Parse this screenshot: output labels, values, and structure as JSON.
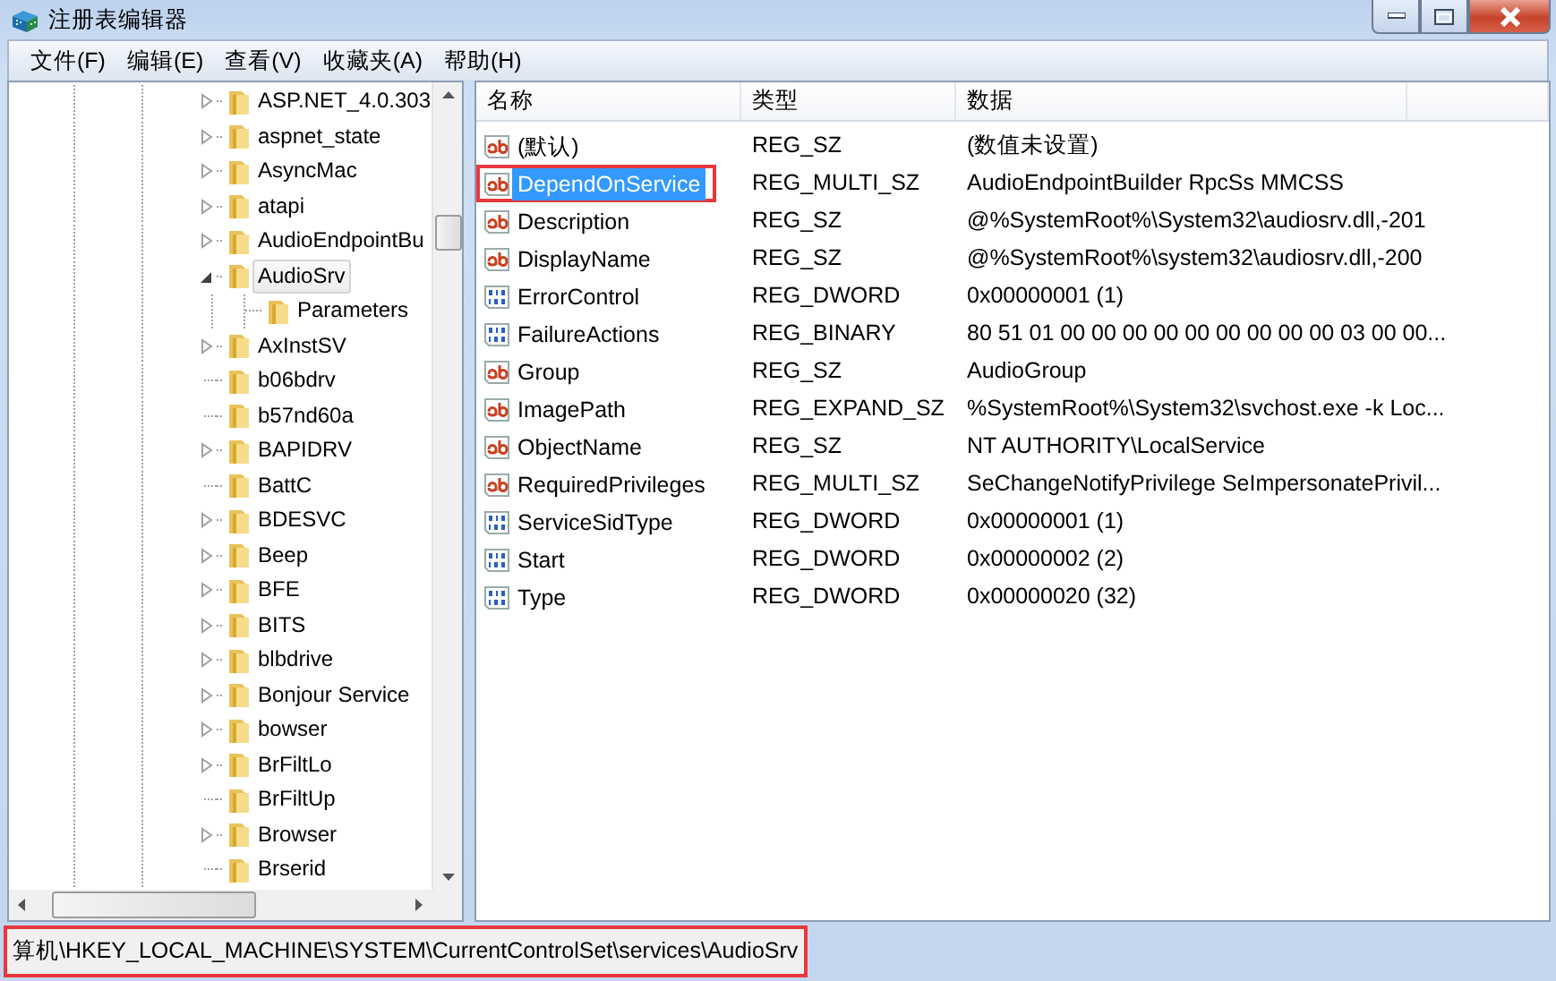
{
  "window": {
    "title": "注册表编辑器"
  },
  "menu": [
    {
      "label": "文件(F)"
    },
    {
      "label": "编辑(E)"
    },
    {
      "label": "查看(V)"
    },
    {
      "label": "收藏夹(A)"
    },
    {
      "label": "帮助(H)"
    }
  ],
  "tree": {
    "items": [
      {
        "label": "ASP.NET_4.0.303",
        "expanded": false,
        "selected": false
      },
      {
        "label": "aspnet_state",
        "expanded": false,
        "selected": false
      },
      {
        "label": "AsyncMac",
        "expanded": false,
        "selected": false
      },
      {
        "label": "atapi",
        "expanded": false,
        "selected": false
      },
      {
        "label": "AudioEndpointBu",
        "expanded": false,
        "selected": false
      },
      {
        "label": "AudioSrv",
        "expanded": true,
        "selected": true,
        "children": [
          {
            "label": "Parameters",
            "selected": false
          }
        ]
      },
      {
        "label": "AxInstSV",
        "expanded": false,
        "selected": false
      },
      {
        "label": "b06bdrv",
        "selected": false
      },
      {
        "label": "b57nd60a",
        "selected": false
      },
      {
        "label": "BAPIDRV",
        "expanded": false,
        "selected": false
      },
      {
        "label": "BattC",
        "selected": false
      },
      {
        "label": "BDESVC",
        "expanded": false,
        "selected": false
      },
      {
        "label": "Beep",
        "expanded": false,
        "selected": false
      },
      {
        "label": "BFE",
        "expanded": false,
        "selected": false
      },
      {
        "label": "BITS",
        "expanded": false,
        "selected": false
      },
      {
        "label": "blbdrive",
        "expanded": false,
        "selected": false
      },
      {
        "label": "Bonjour Service",
        "expanded": false,
        "selected": false
      },
      {
        "label": "bowser",
        "expanded": false,
        "selected": false
      },
      {
        "label": "BrFiltLo",
        "expanded": false,
        "selected": false
      },
      {
        "label": "BrFiltUp",
        "selected": false
      },
      {
        "label": "Browser",
        "expanded": false,
        "selected": false
      },
      {
        "label": "Brserid",
        "selected": false
      }
    ]
  },
  "values": {
    "columns": [
      "名称",
      "类型",
      "数据"
    ],
    "rows": [
      {
        "name": "(默认)",
        "type": "REG_SZ",
        "data": "(数值未设置)",
        "kind": "string",
        "selected": false,
        "annotated": false
      },
      {
        "name": "DependOnService",
        "type": "REG_MULTI_SZ",
        "data": "AudioEndpointBuilder RpcSs MMCSS",
        "kind": "string",
        "selected": true,
        "annotated": true
      },
      {
        "name": "Description",
        "type": "REG_SZ",
        "data": "@%SystemRoot%\\System32\\audiosrv.dll,-201",
        "kind": "string",
        "selected": false,
        "annotated": false
      },
      {
        "name": "DisplayName",
        "type": "REG_SZ",
        "data": "@%SystemRoot%\\system32\\audiosrv.dll,-200",
        "kind": "string",
        "selected": false,
        "annotated": false
      },
      {
        "name": "ErrorControl",
        "type": "REG_DWORD",
        "data": "0x00000001 (1)",
        "kind": "binary",
        "selected": false,
        "annotated": false
      },
      {
        "name": "FailureActions",
        "type": "REG_BINARY",
        "data": "80 51 01 00 00 00 00 00 00 00 00 00 03 00 00...",
        "kind": "binary",
        "selected": false,
        "annotated": false
      },
      {
        "name": "Group",
        "type": "REG_SZ",
        "data": "AudioGroup",
        "kind": "string",
        "selected": false,
        "annotated": false
      },
      {
        "name": "ImagePath",
        "type": "REG_EXPAND_SZ",
        "data": "%SystemRoot%\\System32\\svchost.exe -k Loc...",
        "kind": "string",
        "selected": false,
        "annotated": false
      },
      {
        "name": "ObjectName",
        "type": "REG_SZ",
        "data": "NT AUTHORITY\\LocalService",
        "kind": "string",
        "selected": false,
        "annotated": false
      },
      {
        "name": "RequiredPrivileges",
        "type": "REG_MULTI_SZ",
        "data": "SeChangeNotifyPrivilege SeImpersonatePrivil...",
        "kind": "string",
        "selected": false,
        "annotated": false
      },
      {
        "name": "ServiceSidType",
        "type": "REG_DWORD",
        "data": "0x00000001 (1)",
        "kind": "binary",
        "selected": false,
        "annotated": false
      },
      {
        "name": "Start",
        "type": "REG_DWORD",
        "data": "0x00000002 (2)",
        "kind": "binary",
        "selected": false,
        "annotated": false
      },
      {
        "name": "Type",
        "type": "REG_DWORD",
        "data": "0x00000020 (32)",
        "kind": "binary",
        "selected": false,
        "annotated": false
      }
    ]
  },
  "status_bar": {
    "path": "算机\\HKEY_LOCAL_MACHINE\\SYSTEM\\CurrentControlSet\\services\\AudioSrv",
    "annotated": true
  }
}
